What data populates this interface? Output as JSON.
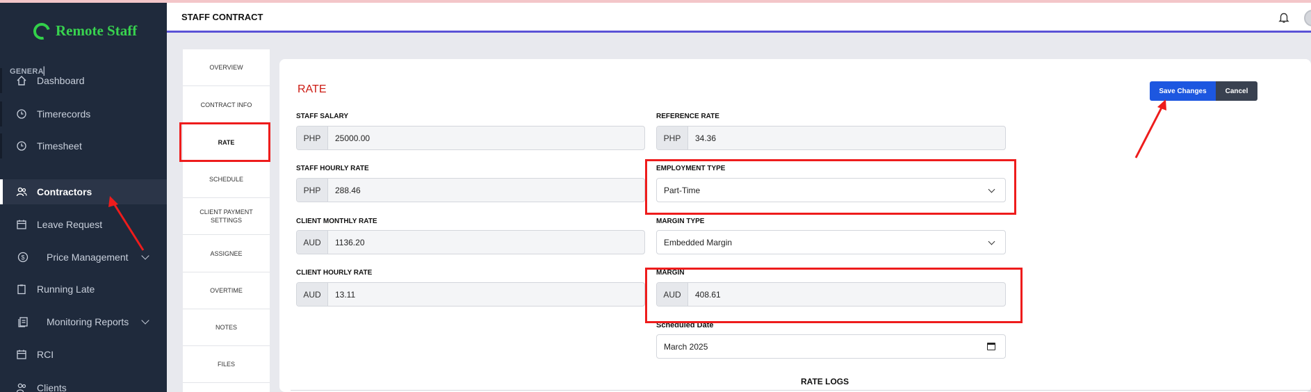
{
  "sidebar": {
    "logo": "Remote Staff",
    "section": "GENERA▏",
    "items": [
      {
        "label": "Dashboard",
        "icon": "home-icon"
      },
      {
        "label": "Timerecords",
        "icon": "clock-icon"
      },
      {
        "label": "Timesheet",
        "icon": "clock-icon"
      },
      {
        "label": "Contractors",
        "icon": "users-icon",
        "active": true
      },
      {
        "label": "Leave Request",
        "icon": "calendar-icon"
      },
      {
        "label": "Price Management",
        "icon": "dollar-icon",
        "expandable": true
      },
      {
        "label": "Running Late",
        "icon": "clipboard-icon"
      },
      {
        "label": "Monitoring Reports",
        "icon": "report-icon",
        "expandable": true
      },
      {
        "label": "RCI",
        "icon": "calendar-icon"
      },
      {
        "label": "Clients",
        "icon": "users-icon"
      }
    ]
  },
  "header": {
    "title": "STAFF CONTRACT"
  },
  "tabs": [
    {
      "label": "OVERVIEW"
    },
    {
      "label": "CONTRACT INFO"
    },
    {
      "label": "RATE",
      "active": true
    },
    {
      "label": "SCHEDULE"
    },
    {
      "label": "CLIENT PAYMENT SETTINGS"
    },
    {
      "label": "ASSIGNEE"
    },
    {
      "label": "OVERTIME"
    },
    {
      "label": "NOTES"
    },
    {
      "label": "FILES"
    }
  ],
  "main": {
    "heading": "RATE",
    "save_label": "Save Changes",
    "cancel_label": "Cancel",
    "staff_salary": {
      "label": "STAFF SALARY",
      "currency": "PHP",
      "value": "25000.00"
    },
    "staff_hourly_rate": {
      "label": "STAFF HOURLY RATE",
      "currency": "PHP",
      "value": "288.46"
    },
    "client_monthly_rate": {
      "label": "CLIENT MONTHLY RATE",
      "currency": "AUD",
      "value": "1136.20"
    },
    "client_hourly_rate": {
      "label": "CLIENT HOURLY RATE",
      "currency": "AUD",
      "value": "13.11"
    },
    "reference_rate": {
      "label": "REFERENCE RATE",
      "currency": "PHP",
      "value": "34.36"
    },
    "employment_type": {
      "label": "EMPLOYMENT TYPE",
      "value": "Part-Time"
    },
    "margin_type": {
      "label": "MARGIN TYPE",
      "value": "Embedded Margin"
    },
    "margin": {
      "label": "MARGIN",
      "currency": "AUD",
      "value": "408.61"
    },
    "scheduled_date": {
      "label": "Scheduled Date",
      "value": "March  2025"
    },
    "rate_logs": "RATE LOGS"
  },
  "colors": {
    "sidebar_bg": "#1f2a3c",
    "brand_green": "#38d24f",
    "header_underline": "#5a52d6",
    "heading_red": "#cc1a12",
    "save_blue": "#1d57e0",
    "cancel_dark": "#394150",
    "annotation_red": "#ee1c1c"
  }
}
